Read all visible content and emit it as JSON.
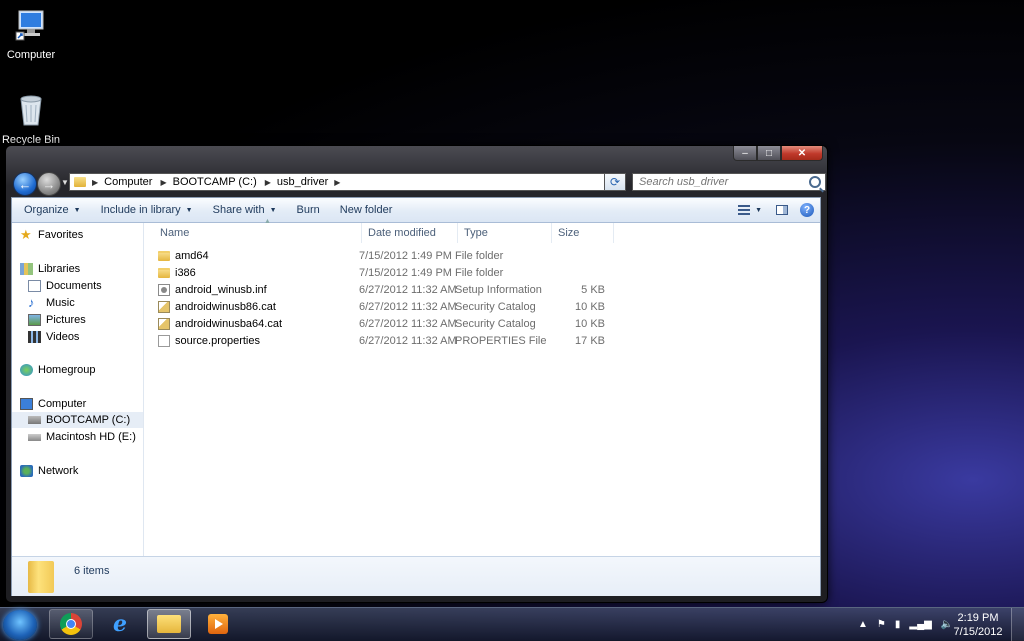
{
  "desktop": {
    "icons": [
      {
        "label": "Computer",
        "icon": "computer-icon"
      },
      {
        "label": "Recycle Bin",
        "icon": "recycle-bin-icon"
      }
    ]
  },
  "window": {
    "caption_buttons": {
      "minimize": "–",
      "maximize": "□",
      "close": "✕"
    },
    "breadcrumb": [
      "Computer",
      "BOOTCAMP (C:)",
      "usb_driver"
    ],
    "search_placeholder": "Search usb_driver",
    "toolbar": {
      "organize": "Organize",
      "include_in_library": "Include in library",
      "share_with": "Share with",
      "burn": "Burn",
      "new_folder": "New folder"
    },
    "nav": {
      "favorites": "Favorites",
      "libraries": "Libraries",
      "documents": "Documents",
      "music": "Music",
      "pictures": "Pictures",
      "videos": "Videos",
      "homegroup": "Homegroup",
      "computer": "Computer",
      "bootcamp": "BOOTCAMP (C:)",
      "macintosh_hd": "Macintosh HD (E:)",
      "network": "Network"
    },
    "columns": {
      "name": "Name",
      "date_modified": "Date modified",
      "type": "Type",
      "size": "Size"
    },
    "files": [
      {
        "name": "amd64",
        "date": "7/15/2012 1:49 PM",
        "type": "File folder",
        "size": "",
        "icon": "folder-icon"
      },
      {
        "name": "i386",
        "date": "7/15/2012 1:49 PM",
        "type": "File folder",
        "size": "",
        "icon": "folder-icon"
      },
      {
        "name": "android_winusb.inf",
        "date": "6/27/2012 11:32 AM",
        "type": "Setup Information",
        "size": "5 KB",
        "icon": "setup-file-icon"
      },
      {
        "name": "androidwinusb86.cat",
        "date": "6/27/2012 11:32 AM",
        "type": "Security Catalog",
        "size": "10 KB",
        "icon": "catalog-file-icon"
      },
      {
        "name": "androidwinusba64.cat",
        "date": "6/27/2012 11:32 AM",
        "type": "Security Catalog",
        "size": "10 KB",
        "icon": "catalog-file-icon"
      },
      {
        "name": "source.properties",
        "date": "6/27/2012 11:32 AM",
        "type": "PROPERTIES File",
        "size": "17 KB",
        "icon": "file-icon"
      }
    ],
    "status": {
      "item_count": "6 items"
    }
  },
  "taskbar": {
    "buttons": [
      "start-button",
      "chrome",
      "internet-explorer",
      "windows-explorer",
      "media-player"
    ],
    "clock": {
      "time": "2:19 PM",
      "date": "7/15/2012"
    }
  }
}
